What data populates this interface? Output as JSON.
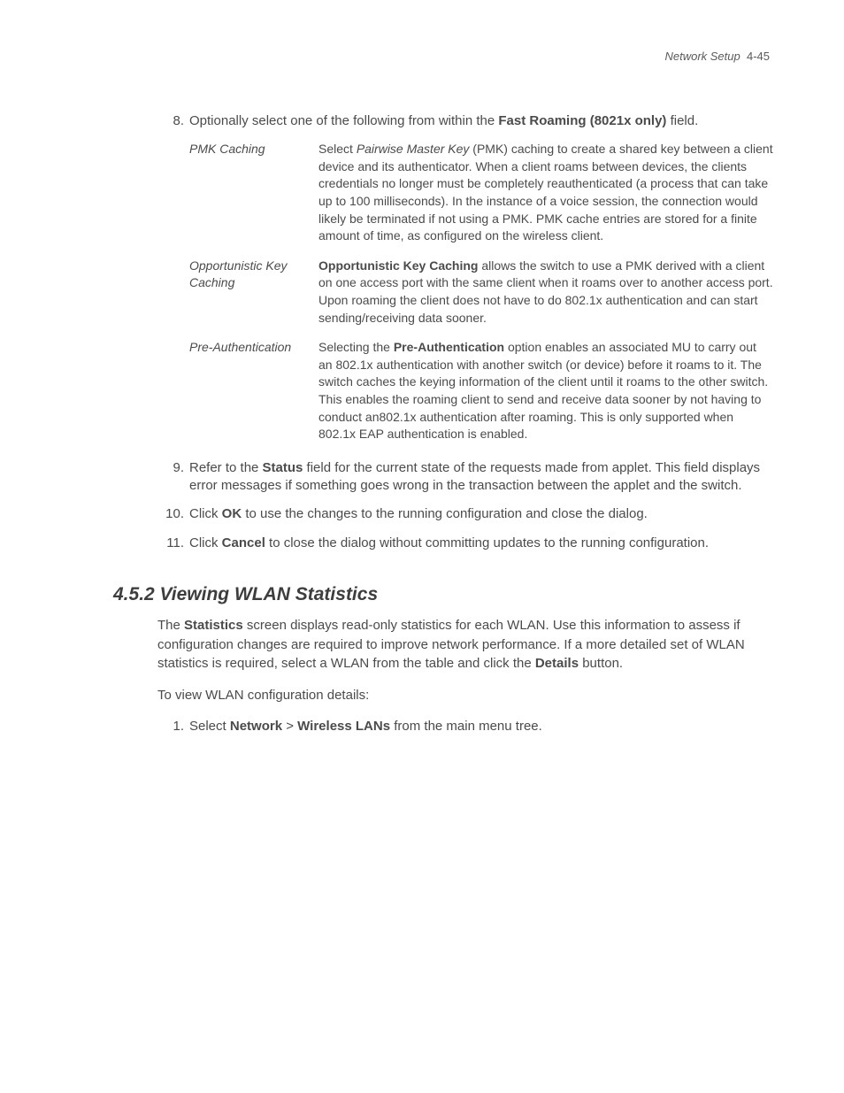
{
  "header": {
    "chapter": "Network Setup",
    "page": "4-45"
  },
  "step8": {
    "no": "8.",
    "pre": "Optionally select one of the following from within the ",
    "field": "Fast Roaming (8021x only)",
    "post": " field."
  },
  "table": [
    {
      "term": "PMK Caching",
      "def_pre": "Select ",
      "def_em": "Pairwise Master Key",
      "def_post": " (PMK) caching to create a shared key between a client device and its authenticator. When a client roams between devices, the clients credentials no longer must be completely reauthenticated (a process that can take up to 100 milliseconds). In the instance of a voice session, the connection would likely be terminated if not using a PMK. PMK cache entries are stored for a finite amount of time, as configured on the wireless client."
    },
    {
      "term": "Opportunistic Key Caching",
      "def_bold": "Opportunistic Key Caching",
      "def_post": " allows the switch to use a PMK derived with a client on one access port with the same client when it roams over to another access port. Upon roaming the client does not have to do 802.1x authentication and can start sending/receiving data sooner."
    },
    {
      "term": "Pre-Authentication",
      "def_pre": "Selecting the ",
      "def_bold": "Pre-Authentication",
      "def_post": " option enables an associated MU to carry out an 802.1x authentication with another switch (or device) before it roams to it. The switch caches the keying information of the client until it roams to the other switch. This enables the roaming client to send and receive data sooner by not having to conduct an802.1x authentication after roaming. This is only supported when 802.1x EAP authentication is enabled."
    }
  ],
  "step9": {
    "no": "9.",
    "pre": "Refer to the ",
    "bold": "Status",
    "post": " field for the current state of the requests made from applet. This field displays error messages if something goes wrong in the transaction between the applet and the switch."
  },
  "step10": {
    "no": "10.",
    "pre": "Click ",
    "bold": "OK",
    "post": " to use the changes to the running configuration and close the dialog."
  },
  "step11": {
    "no": "11.",
    "pre": "Click ",
    "bold": "Cancel",
    "post": " to close the dialog without committing updates to the running configuration."
  },
  "section": {
    "heading": "4.5.2  Viewing WLAN Statistics",
    "para1_pre": "The ",
    "para1_bold1": "Statistics",
    "para1_mid": " screen displays read-only statistics for each WLAN. Use this information to assess if configuration changes are required to improve network performance. If a more detailed set of WLAN statistics is required, select a WLAN from the table and click the ",
    "para1_bold2": "Details",
    "para1_post": " button.",
    "para2": "To view WLAN configuration details:",
    "step1_no": "1.",
    "step1_pre": "Select ",
    "step1_bold1": "Network",
    "step1_mid": " > ",
    "step1_bold2": "Wireless LANs",
    "step1_post": " from the main menu tree."
  }
}
